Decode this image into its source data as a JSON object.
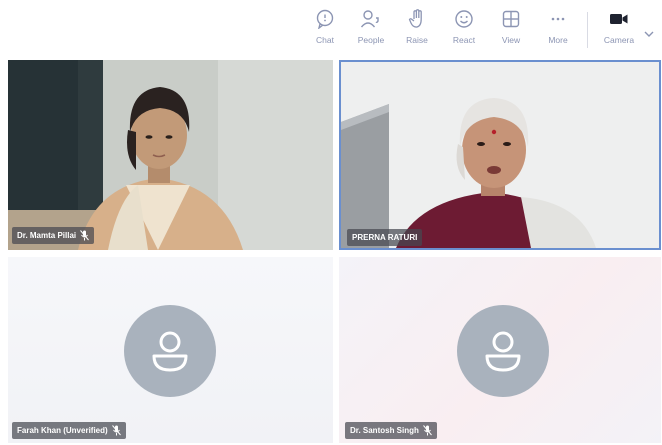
{
  "toolbar": {
    "items": [
      {
        "label": "Chat",
        "icon": "chat-icon"
      },
      {
        "label": "People",
        "icon": "people-icon"
      },
      {
        "label": "Raise",
        "icon": "raise-hand-icon"
      },
      {
        "label": "React",
        "icon": "react-icon"
      },
      {
        "label": "View",
        "icon": "view-icon"
      },
      {
        "label": "More",
        "icon": "more-icon"
      },
      {
        "label": "Camera",
        "icon": "camera-icon"
      }
    ],
    "accent_color": "#8c95b3"
  },
  "participants": [
    {
      "name": "Dr. Mamta Pillai",
      "video": true
    },
    {
      "name": "PRERNA RATURI",
      "video": true,
      "active_speaker": true
    },
    {
      "name": "Farah Khan (Unverified)",
      "video": false
    },
    {
      "name": "Dr. Santosh Singh",
      "video": false
    }
  ],
  "colors": {
    "active_border": "#6a8fcf",
    "avatar_bg": "#a9b2bd",
    "name_tag_bg": "#46485a"
  }
}
